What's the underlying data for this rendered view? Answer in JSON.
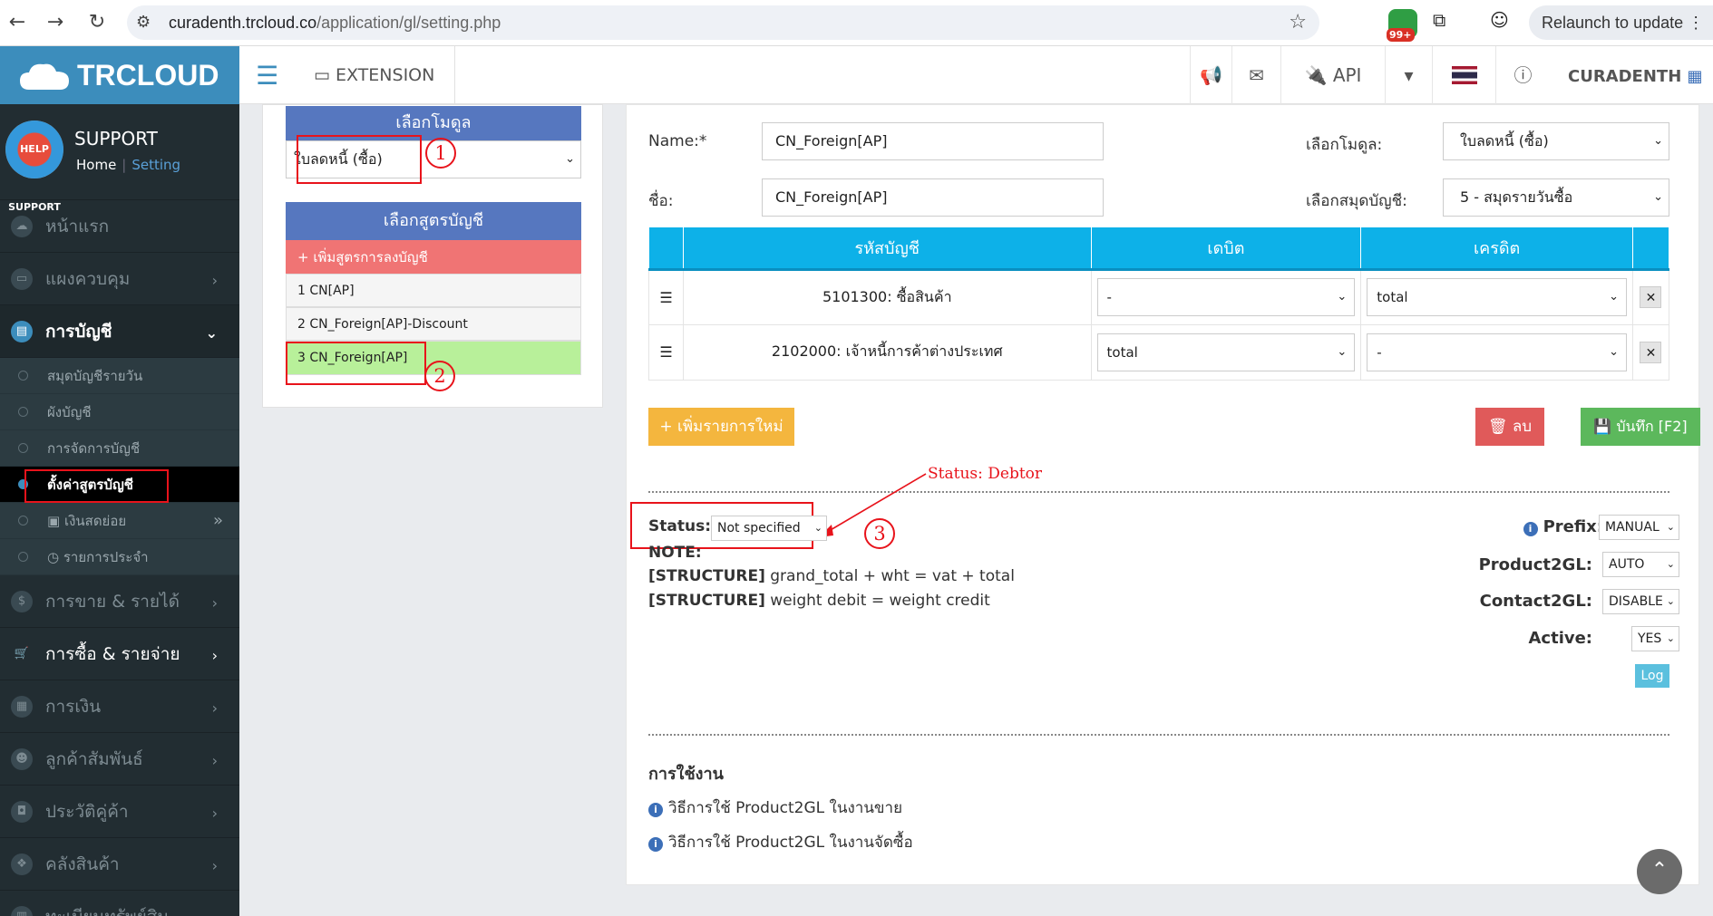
{
  "browser": {
    "url_host": "curadenth.trcloud.co",
    "url_path": "/application/gl/setting.php",
    "badge": "99+",
    "relaunch": "Relaunch to update"
  },
  "header": {
    "logo": "TRCLOUD",
    "extension": "EXTENSION",
    "api": "API",
    "user": "CURADENTH"
  },
  "sidebar": {
    "avatar_text": "HELP SUPPORT",
    "name": "SUPPORT",
    "home": "Home",
    "separator": "|",
    "setting": "Setting",
    "items": [
      {
        "label": "หน้าแรก"
      },
      {
        "label": "แผงควบคุม"
      },
      {
        "label": "การบัญชี"
      },
      {
        "label": "การขาย & รายได้"
      },
      {
        "label": "การซื้อ & รายจ่าย"
      },
      {
        "label": "การเงิน"
      },
      {
        "label": "ลูกค้าสัมพันธ์"
      },
      {
        "label": "ประวัติคู่ค้า"
      },
      {
        "label": "คลังสินค้า"
      },
      {
        "label": "ทะเบียนทรัพย์สิน"
      }
    ],
    "subitems": [
      {
        "label": "สมุดบัญชีรายวัน"
      },
      {
        "label": "ผังบัญชี"
      },
      {
        "label": "การจัดการบัญชี"
      },
      {
        "label": "ตั้งค่าสูตรบัญชี"
      },
      {
        "label": "เงินสดย่อย"
      },
      {
        "label": "รายการประจำ"
      }
    ]
  },
  "left": {
    "module_header": "เลือกโมดูล",
    "module_value": "ใบลดหนี้ (ซื้อ)",
    "formula_header": "เลือกสูตรบัญชี",
    "add_formula": "+ เพิ่มสูตรการลงบัญชี",
    "formulas": [
      {
        "label": "1 CN[AP]"
      },
      {
        "label": "2 CN_Foreign[AP]-Discount"
      },
      {
        "label": "3 CN_Foreign[AP]"
      }
    ]
  },
  "form": {
    "name_label": "Name:*",
    "name_value": "CN_Foreign[AP]",
    "thai_name_label": "ชื่อ:",
    "thai_name_value": "CN_Foreign[AP]",
    "module_label": "เลือกโมดูล:",
    "module_value": "ใบลดหนี้ (ซื้อ)",
    "journal_label": "เลือกสมุดบัญชี:",
    "journal_value": "5 - สมุดรายวันซื้อ"
  },
  "table": {
    "headers": [
      "รหัสบัญชี",
      "เดบิต",
      "เครดิต"
    ],
    "rows": [
      {
        "account": "5101300: ซื้อสินค้า",
        "debit": "-",
        "credit": "total"
      },
      {
        "account": "2102000: เจ้าหนี้การค้าต่างประเทศ",
        "debit": "total",
        "credit": "-"
      }
    ]
  },
  "buttons": {
    "add_row": "+ เพิ่มรายการใหม่",
    "delete": "ลบ",
    "save": "บันทึก [F2]",
    "log": "Log"
  },
  "status": {
    "label": "Status:",
    "value": "Not specified",
    "note": "NOTE:",
    "struct1_tag": "[STRUCTURE]",
    "struct1": "grand_total + wht = vat + total",
    "struct2_tag": "[STRUCTURE]",
    "struct2": "weight debit = weight credit"
  },
  "settings": {
    "prefix_label": "Prefix:",
    "prefix_value": "MANUAL",
    "product2gl_label": "Product2GL:",
    "product2gl_value": "AUTO",
    "contact2gl_label": "Contact2GL:",
    "contact2gl_value": "DISABLE",
    "active_label": "Active:",
    "active_value": "YES"
  },
  "usage": {
    "title": "การใช้งาน",
    "link1": "วิธีการใช้ Product2GL ในงานขาย",
    "link2": "วิธีการใช้ Product2GL ในงานจัดซื้อ"
  },
  "annotations": {
    "status_note": "Status:  Debtor",
    "n1": "1",
    "n2": "2",
    "n3": "3"
  },
  "colors": {
    "accent": "#3c8dbc",
    "table_header": "#0db1e8",
    "add_button": "#f4b63e",
    "delete_button": "#e05a5a",
    "save_button": "#5cb85c",
    "selected_formula": "#b8f09a",
    "annotation": "#e8131b"
  }
}
